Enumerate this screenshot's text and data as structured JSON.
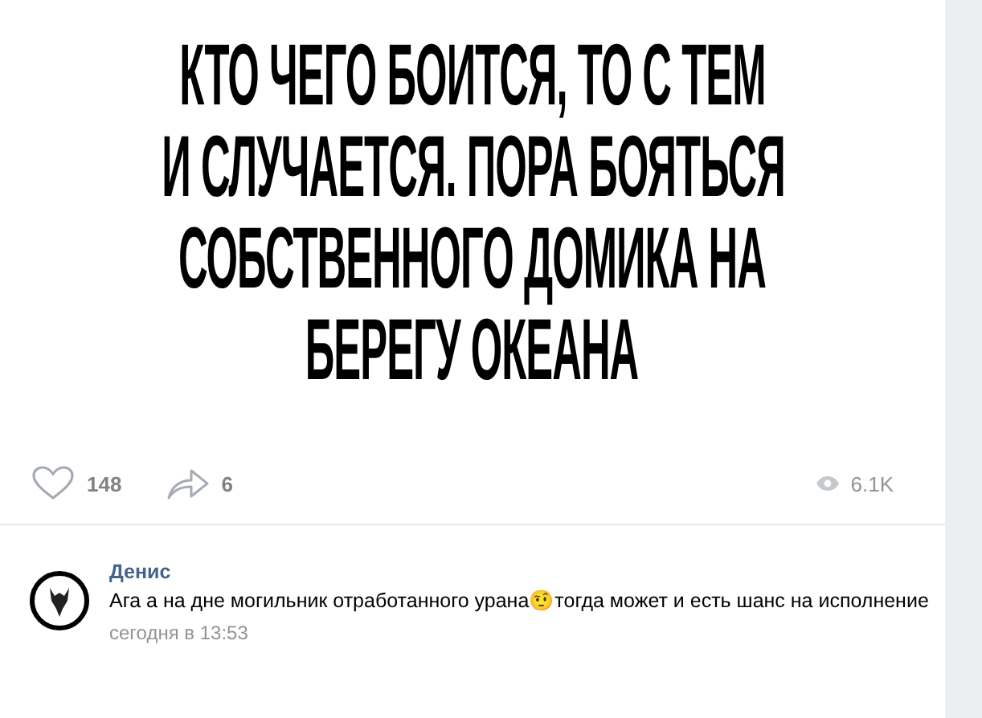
{
  "post": {
    "image_text": [
      "КТО ЧЕГО БОИТСЯ, ТО С ТЕМ",
      "И СЛУЧАЕТСЯ. ПОРА БОЯТЬСЯ",
      "СОБСТВЕННОГО ДОМИКА НА",
      "БЕРЕГУ ОКЕАНА"
    ],
    "likes": "148",
    "shares": "6",
    "views": "6.1K"
  },
  "comment": {
    "author": "Денис",
    "text": "Ага а на дне могильник отработанного урана",
    "emoji": "🤨",
    "text_after": "тогда может и есть шанс на исполнение",
    "time": "сегодня в 13:53"
  }
}
